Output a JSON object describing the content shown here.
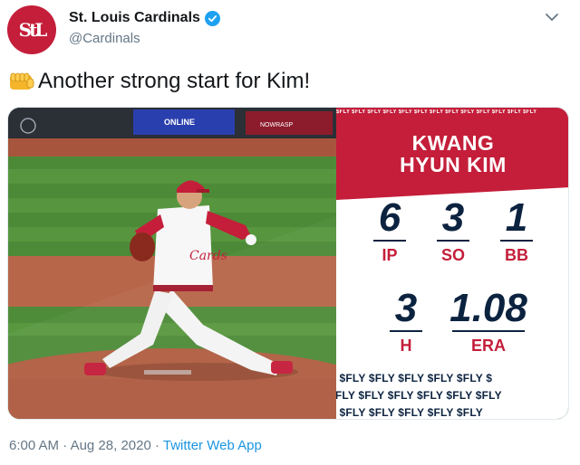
{
  "author": {
    "display_name": "St. Louis Cardinals",
    "handle": "@Cardinals",
    "avatar_icon": "cardinals-stl-logo",
    "verified_icon": "verified-badge-icon",
    "brand_color": "#c41e3a"
  },
  "tweet": {
    "emoji_icon": "raised-fist-icon",
    "text": "Another strong start for Kim!"
  },
  "media": {
    "banner_text": "ONLINE",
    "wall_sign": "NOWRASP",
    "card": {
      "fly_strip": "$FLY $FLY $FLY $FLY $FLY $FLY $FLY $FLY $FLY $FLY $FLY $FLY $FLY",
      "first_name": "KWANG",
      "last_name": "HYUN KIM",
      "stats": {
        "ip": {
          "value": "6",
          "label": "IP"
        },
        "so": {
          "value": "3",
          "label": "SO"
        },
        "bb": {
          "value": "1",
          "label": "BB"
        },
        "h": {
          "value": "3",
          "label": "H"
        },
        "era": {
          "value": "1.08",
          "label": "ERA"
        }
      },
      "fly_row_1": "Y $FLY $FLY $FLY $FLY $FLY $",
      "fly_row_2": "$FLY $FLY $FLY $FLY $FLY $FLY",
      "fly_row_3": "Y $FLY $FLY $FLY $FLY $FLY"
    }
  },
  "footer": {
    "time": "6:00 AM",
    "separator": " · ",
    "date": "Aug 28, 2020",
    "app": "Twitter Web App"
  }
}
